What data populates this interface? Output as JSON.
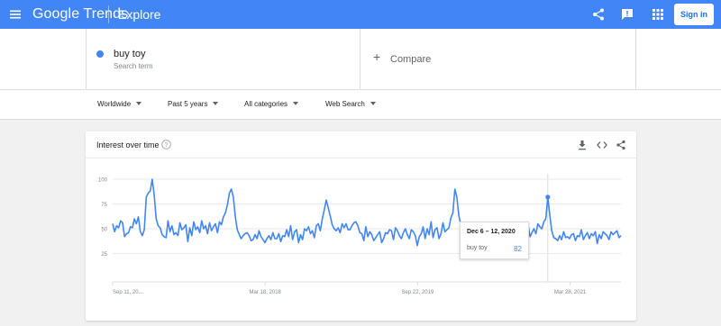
{
  "header": {
    "brand": "Google Trends",
    "section": "Explore",
    "signin_label": "Sign in",
    "icons": [
      "menu-icon",
      "share-icon",
      "feedback-icon",
      "apps-icon"
    ]
  },
  "search": {
    "term": "buy toy",
    "term_type": "Search term",
    "term_color": "#4285f4",
    "compare_label": "Compare"
  },
  "filters": {
    "region": "Worldwide",
    "time": "Past 5 years",
    "category": "All categories",
    "property": "Web Search"
  },
  "card": {
    "title": "Interest over time",
    "icons": [
      "help-icon",
      "download-icon",
      "embed-icon",
      "share-icon"
    ]
  },
  "tooltip": {
    "date": "Dec 6 – 12, 2020",
    "label": "buy toy",
    "value": "82"
  },
  "chart_data": {
    "type": "line",
    "series": [
      {
        "name": "buy toy",
        "color": "#4285f4",
        "values": [
          55,
          47,
          53,
          51,
          58,
          56,
          42,
          45,
          46,
          52,
          51,
          60,
          55,
          62,
          47,
          43,
          49,
          82,
          86,
          88,
          100,
          84,
          60,
          53,
          51,
          44,
          42,
          41,
          58,
          47,
          53,
          44,
          46,
          43,
          56,
          49,
          51,
          54,
          37,
          51,
          43,
          57,
          49,
          52,
          46,
          58,
          50,
          53,
          45,
          56,
          48,
          52,
          55,
          46,
          57,
          54,
          62,
          66,
          74,
          86,
          90,
          82,
          62,
          49,
          44,
          40,
          43,
          45,
          46,
          43,
          38,
          39,
          44,
          40,
          48,
          42,
          39,
          36,
          40,
          43,
          39,
          46,
          40,
          40,
          45,
          37,
          43,
          42,
          49,
          42,
          53,
          39,
          47,
          49,
          36,
          44,
          39,
          50,
          48,
          52,
          45,
          48,
          41,
          53,
          55,
          48,
          60,
          69,
          79,
          71,
          63,
          54,
          50,
          48,
          51,
          46,
          55,
          51,
          55,
          49,
          49,
          53,
          56,
          57,
          53,
          46,
          45,
          38,
          52,
          42,
          47,
          44,
          38,
          41,
          44,
          47,
          36,
          40,
          46,
          45,
          49,
          48,
          39,
          51,
          48,
          43,
          40,
          46,
          50,
          44,
          40,
          49,
          47,
          43,
          33,
          42,
          45,
          52,
          40,
          50,
          44,
          57,
          41,
          49,
          51,
          40,
          45,
          56,
          47,
          49,
          51,
          61,
          66,
          90,
          82,
          64,
          54,
          44,
          40,
          38,
          36,
          38,
          52,
          40,
          46,
          42,
          48,
          39,
          37,
          44,
          38,
          45,
          38,
          45,
          54,
          43,
          50,
          48,
          47,
          44,
          48,
          37,
          44,
          47,
          44,
          49,
          44,
          37,
          48,
          38,
          54,
          42,
          46,
          50,
          45,
          55,
          52,
          50,
          57,
          60,
          82,
          64,
          48,
          41,
          40,
          38,
          43,
          39,
          47,
          41,
          42,
          40,
          44,
          45,
          38,
          43,
          42,
          49,
          39,
          43,
          46,
          40,
          45,
          43,
          47,
          35,
          44,
          40,
          47,
          45,
          43,
          39,
          47,
          44,
          46,
          48,
          41,
          43
        ]
      }
    ],
    "ylim": [
      0,
      100
    ],
    "yticks": [
      25,
      50,
      75,
      100
    ],
    "xtick_labels": [
      "Sep 11, 20…",
      "Mar 18, 2018",
      "Sep 22, 2019",
      "Mar 28, 2021"
    ],
    "grid": true,
    "highlight_value": 82
  }
}
